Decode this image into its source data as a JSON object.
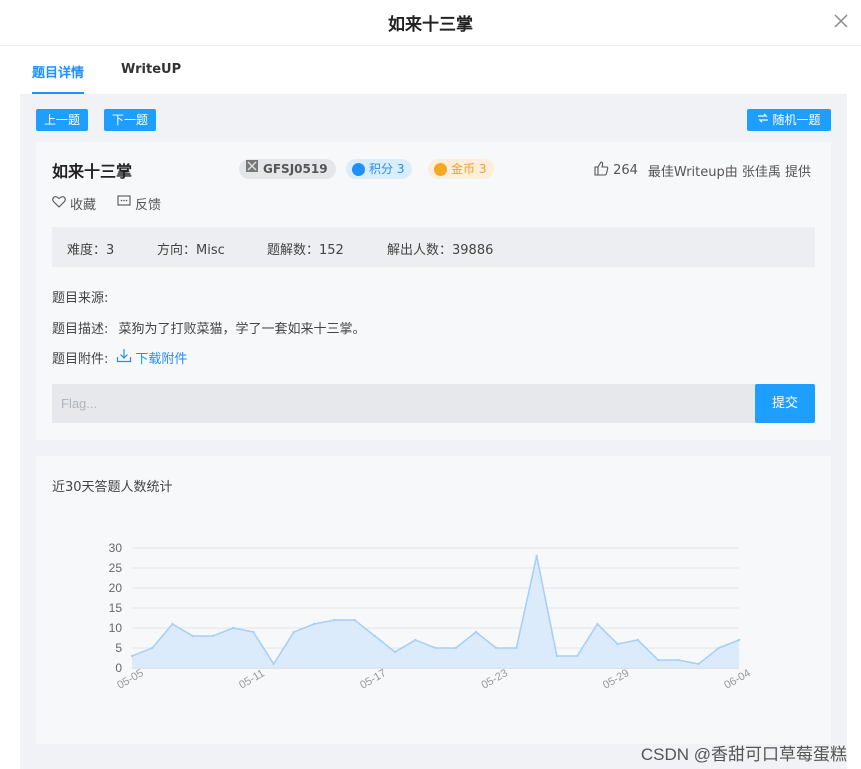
{
  "modal": {
    "title": "如来十三掌"
  },
  "tabs": [
    {
      "label": "题目详情",
      "active": true
    },
    {
      "label": "WriteUP",
      "active": false
    }
  ],
  "nav": {
    "prev": "上一题",
    "next": "下一题",
    "random": "随机一题"
  },
  "question": {
    "title": "如来十三掌",
    "tags": {
      "id": "GFSJ0519",
      "score": "积分 3",
      "coins": "金币 3"
    },
    "likes": "264",
    "best_writeup": "最佳Writeup由 张佳禹 提供",
    "favorite": "收藏",
    "feedback": "反馈",
    "stats": {
      "difficulty": "难度：3",
      "direction": "方向：Misc",
      "solves": "题解数：152",
      "solvers": "解出人数：39886"
    },
    "source": "题目来源:",
    "desc_label": "题目描述:",
    "desc_text": "菜狗为了打败菜猫，学了一套如来十三掌。",
    "attach_label": "题目附件:",
    "download": "下载附件",
    "flag_placeholder": "Flag...",
    "submit": "提交"
  },
  "chart_title": "近30天答题人数统计",
  "chart_data": {
    "type": "area",
    "title": "近30天答题人数统计",
    "xlabel": "",
    "ylabel": "",
    "ylim": [
      0,
      30
    ],
    "yticks": [
      0,
      5,
      10,
      15,
      20,
      25,
      30
    ],
    "x": [
      "05-05",
      "05-06",
      "05-07",
      "05-08",
      "05-09",
      "05-10",
      "05-11",
      "05-12",
      "05-13",
      "05-14",
      "05-15",
      "05-16",
      "05-17",
      "05-18",
      "05-19",
      "05-20",
      "05-21",
      "05-22",
      "05-23",
      "05-24",
      "05-25",
      "05-26",
      "05-27",
      "05-28",
      "05-29",
      "05-30",
      "05-31",
      "06-01",
      "06-02",
      "06-03",
      "06-04"
    ],
    "xtick_labels": [
      "05-05",
      "05-11",
      "05-17",
      "05-23",
      "05-29",
      "06-04"
    ],
    "values": [
      3,
      5,
      11,
      8,
      8,
      10,
      9,
      1,
      9,
      11,
      12,
      12,
      8,
      4,
      7,
      5,
      5,
      9,
      5,
      5,
      28,
      3,
      3,
      11,
      6,
      7,
      2,
      2,
      1,
      5,
      7
    ],
    "grid": true,
    "colors": {
      "line": "#a8d0f5",
      "fill": "#d7e9fb"
    }
  },
  "watermark": "CSDN @香甜可口草莓蛋糕"
}
